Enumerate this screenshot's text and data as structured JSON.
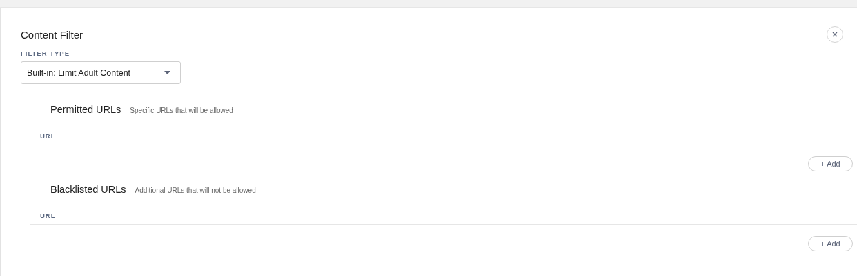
{
  "panel": {
    "title": "Content Filter"
  },
  "filter_type": {
    "label": "FILTER TYPE",
    "value": "Built-in: Limit Adult Content"
  },
  "sections": [
    {
      "title": "Permitted URLs",
      "description": "Specific URLs that will be allowed",
      "column": "URL",
      "button": "+ Add"
    },
    {
      "title": "Blacklisted URLs",
      "description": "Additional URLs that will not be allowed",
      "column": "URL",
      "button": "+ Add"
    }
  ]
}
